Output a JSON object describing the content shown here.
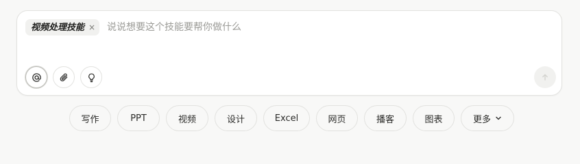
{
  "composer": {
    "skill_chip": {
      "label": "视频处理技能",
      "close_glyph": "×"
    },
    "input": {
      "value": "",
      "placeholder": "说说想要这个技能要帮你做什么"
    },
    "tools": [
      {
        "icon": "at-sign-icon",
        "active": true
      },
      {
        "icon": "paperclip-icon",
        "active": false
      },
      {
        "icon": "lightbulb-icon",
        "active": false
      }
    ],
    "send": {
      "icon": "arrow-up-icon",
      "enabled": false
    }
  },
  "suggestions": [
    {
      "label": "写作"
    },
    {
      "label": "PPT"
    },
    {
      "label": "视频"
    },
    {
      "label": "设计"
    },
    {
      "label": "Excel"
    },
    {
      "label": "网页"
    },
    {
      "label": "播客"
    },
    {
      "label": "图表"
    },
    {
      "label": "更多",
      "icon": "chevron-down-icon"
    }
  ],
  "colors": {
    "page_background": "#f8f8f7",
    "card_background": "#ffffff",
    "border": "#e2e2df",
    "text": "#2b2b29",
    "placeholder": "#9b9b97"
  }
}
